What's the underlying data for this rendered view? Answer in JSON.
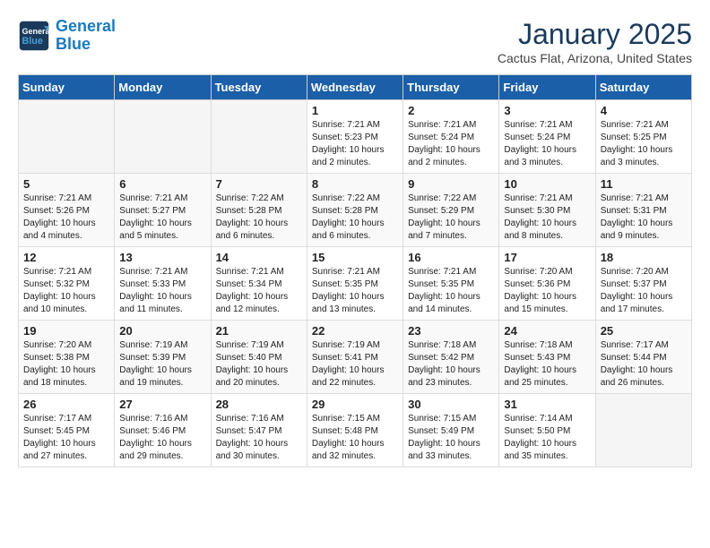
{
  "header": {
    "logo_line1": "General",
    "logo_line2": "Blue",
    "month_title": "January 2025",
    "subtitle": "Cactus Flat, Arizona, United States"
  },
  "weekdays": [
    "Sunday",
    "Monday",
    "Tuesday",
    "Wednesday",
    "Thursday",
    "Friday",
    "Saturday"
  ],
  "weeks": [
    [
      {
        "day": "",
        "info": ""
      },
      {
        "day": "",
        "info": ""
      },
      {
        "day": "",
        "info": ""
      },
      {
        "day": "1",
        "info": "Sunrise: 7:21 AM\nSunset: 5:23 PM\nDaylight: 10 hours\nand 2 minutes."
      },
      {
        "day": "2",
        "info": "Sunrise: 7:21 AM\nSunset: 5:24 PM\nDaylight: 10 hours\nand 2 minutes."
      },
      {
        "day": "3",
        "info": "Sunrise: 7:21 AM\nSunset: 5:24 PM\nDaylight: 10 hours\nand 3 minutes."
      },
      {
        "day": "4",
        "info": "Sunrise: 7:21 AM\nSunset: 5:25 PM\nDaylight: 10 hours\nand 3 minutes."
      }
    ],
    [
      {
        "day": "5",
        "info": "Sunrise: 7:21 AM\nSunset: 5:26 PM\nDaylight: 10 hours\nand 4 minutes."
      },
      {
        "day": "6",
        "info": "Sunrise: 7:21 AM\nSunset: 5:27 PM\nDaylight: 10 hours\nand 5 minutes."
      },
      {
        "day": "7",
        "info": "Sunrise: 7:22 AM\nSunset: 5:28 PM\nDaylight: 10 hours\nand 6 minutes."
      },
      {
        "day": "8",
        "info": "Sunrise: 7:22 AM\nSunset: 5:28 PM\nDaylight: 10 hours\nand 6 minutes."
      },
      {
        "day": "9",
        "info": "Sunrise: 7:22 AM\nSunset: 5:29 PM\nDaylight: 10 hours\nand 7 minutes."
      },
      {
        "day": "10",
        "info": "Sunrise: 7:21 AM\nSunset: 5:30 PM\nDaylight: 10 hours\nand 8 minutes."
      },
      {
        "day": "11",
        "info": "Sunrise: 7:21 AM\nSunset: 5:31 PM\nDaylight: 10 hours\nand 9 minutes."
      }
    ],
    [
      {
        "day": "12",
        "info": "Sunrise: 7:21 AM\nSunset: 5:32 PM\nDaylight: 10 hours\nand 10 minutes."
      },
      {
        "day": "13",
        "info": "Sunrise: 7:21 AM\nSunset: 5:33 PM\nDaylight: 10 hours\nand 11 minutes."
      },
      {
        "day": "14",
        "info": "Sunrise: 7:21 AM\nSunset: 5:34 PM\nDaylight: 10 hours\nand 12 minutes."
      },
      {
        "day": "15",
        "info": "Sunrise: 7:21 AM\nSunset: 5:35 PM\nDaylight: 10 hours\nand 13 minutes."
      },
      {
        "day": "16",
        "info": "Sunrise: 7:21 AM\nSunset: 5:35 PM\nDaylight: 10 hours\nand 14 minutes."
      },
      {
        "day": "17",
        "info": "Sunrise: 7:20 AM\nSunset: 5:36 PM\nDaylight: 10 hours\nand 15 minutes."
      },
      {
        "day": "18",
        "info": "Sunrise: 7:20 AM\nSunset: 5:37 PM\nDaylight: 10 hours\nand 17 minutes."
      }
    ],
    [
      {
        "day": "19",
        "info": "Sunrise: 7:20 AM\nSunset: 5:38 PM\nDaylight: 10 hours\nand 18 minutes."
      },
      {
        "day": "20",
        "info": "Sunrise: 7:19 AM\nSunset: 5:39 PM\nDaylight: 10 hours\nand 19 minutes."
      },
      {
        "day": "21",
        "info": "Sunrise: 7:19 AM\nSunset: 5:40 PM\nDaylight: 10 hours\nand 20 minutes."
      },
      {
        "day": "22",
        "info": "Sunrise: 7:19 AM\nSunset: 5:41 PM\nDaylight: 10 hours\nand 22 minutes."
      },
      {
        "day": "23",
        "info": "Sunrise: 7:18 AM\nSunset: 5:42 PM\nDaylight: 10 hours\nand 23 minutes."
      },
      {
        "day": "24",
        "info": "Sunrise: 7:18 AM\nSunset: 5:43 PM\nDaylight: 10 hours\nand 25 minutes."
      },
      {
        "day": "25",
        "info": "Sunrise: 7:17 AM\nSunset: 5:44 PM\nDaylight: 10 hours\nand 26 minutes."
      }
    ],
    [
      {
        "day": "26",
        "info": "Sunrise: 7:17 AM\nSunset: 5:45 PM\nDaylight: 10 hours\nand 27 minutes."
      },
      {
        "day": "27",
        "info": "Sunrise: 7:16 AM\nSunset: 5:46 PM\nDaylight: 10 hours\nand 29 minutes."
      },
      {
        "day": "28",
        "info": "Sunrise: 7:16 AM\nSunset: 5:47 PM\nDaylight: 10 hours\nand 30 minutes."
      },
      {
        "day": "29",
        "info": "Sunrise: 7:15 AM\nSunset: 5:48 PM\nDaylight: 10 hours\nand 32 minutes."
      },
      {
        "day": "30",
        "info": "Sunrise: 7:15 AM\nSunset: 5:49 PM\nDaylight: 10 hours\nand 33 minutes."
      },
      {
        "day": "31",
        "info": "Sunrise: 7:14 AM\nSunset: 5:50 PM\nDaylight: 10 hours\nand 35 minutes."
      },
      {
        "day": "",
        "info": ""
      }
    ]
  ]
}
